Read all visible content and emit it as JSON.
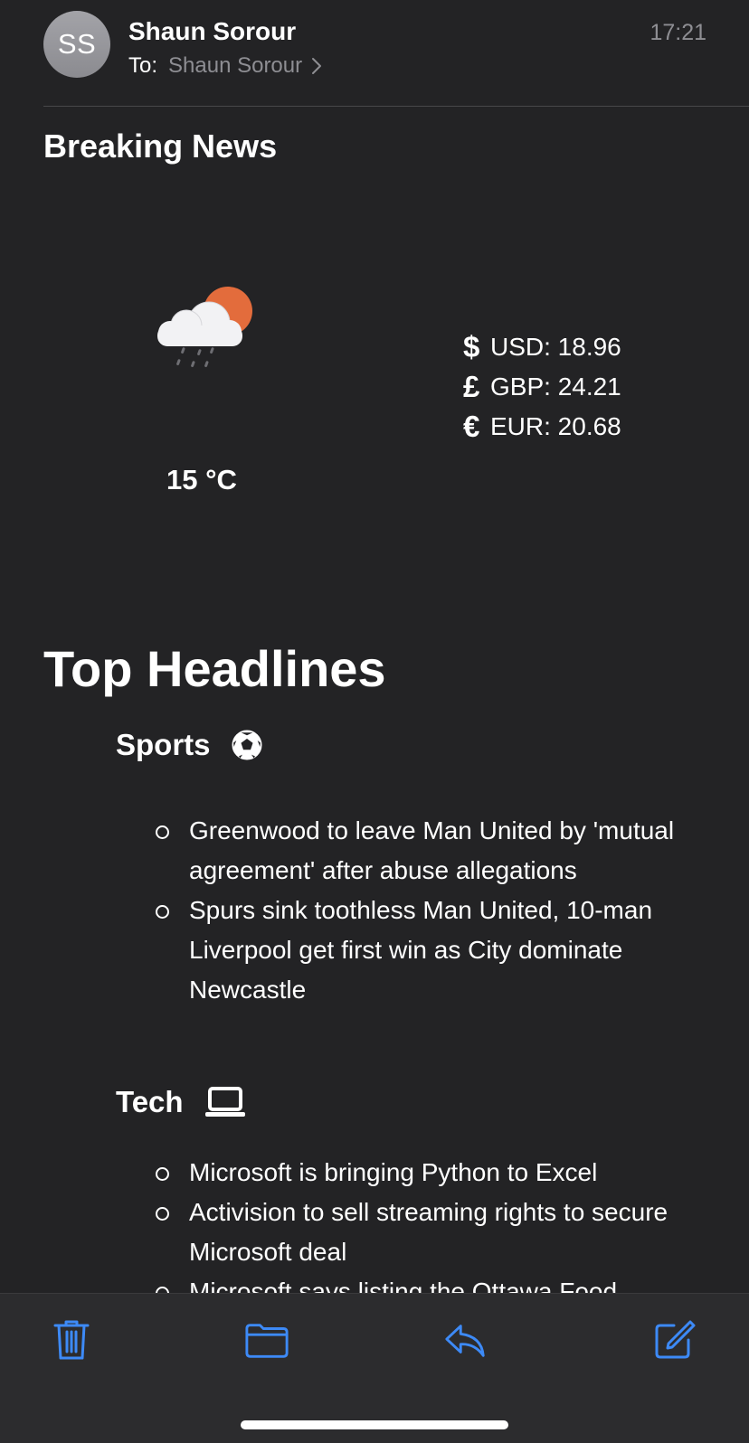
{
  "header": {
    "avatar_initials": "SS",
    "sender": "Shaun Sorour",
    "time": "17:21",
    "to_label": "To:",
    "to_name": "Shaun Sorour"
  },
  "email": {
    "breaking_title": "Breaking News",
    "weather": {
      "icon": "cloud-rain-sun-icon",
      "temperature": "15 °C"
    },
    "rates": [
      {
        "symbol": "$",
        "text": "USD: 18.96"
      },
      {
        "symbol": "£",
        "text": "GBP: 24.21"
      },
      {
        "symbol": "€",
        "text": "EUR: 20.68"
      }
    ],
    "top_headlines_title": "Top Headlines",
    "categories": [
      {
        "name": "Sports",
        "icon": "soccer-ball-icon",
        "items": [
          "Greenwood to leave Man United by 'mutual agreement' after abuse allegations",
          "Spurs sink toothless Man United, 10-man Liverpool get first win as City dominate Newcastle"
        ]
      },
      {
        "name": "Tech",
        "icon": "laptop-icon",
        "items": [
          "Microsoft is bringing Python to Excel",
          "Activision to sell streaming rights to secure Microsoft deal",
          "Microsoft says listing the Ottawa Food"
        ]
      }
    ]
  },
  "toolbar": {
    "buttons": [
      "trash-icon",
      "folder-icon",
      "reply-icon",
      "compose-icon"
    ],
    "accent": "#3d8af7"
  },
  "colors": {
    "background": "#232325",
    "toolbar": "#2c2c2e",
    "secondary_text": "#8e8e93",
    "sun": "#e36c3c"
  }
}
